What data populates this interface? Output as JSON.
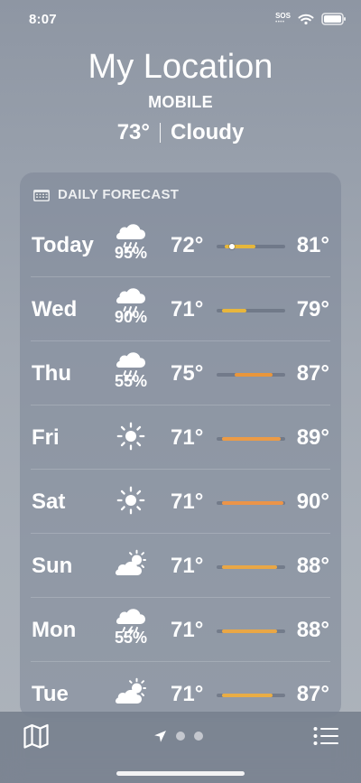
{
  "status_bar": {
    "time": "8:07",
    "sos": "SOS"
  },
  "header": {
    "location_name": "My Location",
    "subtitle": "MOBILE",
    "current_temperature": "73°",
    "current_condition": "Cloudy"
  },
  "forecast": {
    "title": "DAILY FORECAST",
    "days": [
      {
        "day": "Today",
        "icon": "cloud-rain-icon",
        "precip": "95%",
        "low": "72°",
        "high": "81°",
        "range_start": 0.12,
        "range_end": 0.57,
        "current_marker": 0.22,
        "range_color": "#e6b73b"
      },
      {
        "day": "Wed",
        "icon": "cloud-rain-icon",
        "precip": "90%",
        "low": "71°",
        "high": "79°",
        "range_start": 0.08,
        "range_end": 0.44,
        "range_color": "#e8b63c"
      },
      {
        "day": "Thu",
        "icon": "cloud-rain-icon",
        "precip": "55%",
        "low": "75°",
        "high": "87°",
        "range_start": 0.26,
        "range_end": 0.82,
        "range_color": "#e9963b"
      },
      {
        "day": "Fri",
        "icon": "sun-icon",
        "precip": "",
        "low": "71°",
        "high": "89°",
        "range_start": 0.08,
        "range_end": 0.93,
        "range_color": "#ec9b46"
      },
      {
        "day": "Sat",
        "icon": "sun-icon",
        "precip": "",
        "low": "71°",
        "high": "90°",
        "range_start": 0.08,
        "range_end": 0.98,
        "range_color": "#ec9448"
      },
      {
        "day": "Sun",
        "icon": "partly-sunny-icon",
        "precip": "",
        "low": "71°",
        "high": "88°",
        "range_start": 0.08,
        "range_end": 0.88,
        "range_color": "#e9a746"
      },
      {
        "day": "Mon",
        "icon": "cloud-thunderstorm-icon",
        "precip": "55%",
        "low": "71°",
        "high": "88°",
        "range_start": 0.08,
        "range_end": 0.88,
        "range_color": "#e9a746"
      },
      {
        "day": "Tue",
        "icon": "partly-sunny-icon",
        "precip": "",
        "low": "71°",
        "high": "87°",
        "range_start": 0.08,
        "range_end": 0.82,
        "range_color": "#e9ad45"
      }
    ]
  },
  "bottom_bar": {
    "map_icon": "map-icon",
    "location_icon": "location-arrow-icon",
    "list_icon": "list-icon",
    "page_count": 3,
    "current_page": 0
  },
  "colors": {
    "card_background": "#7a8595",
    "track": "#5b6474",
    "text": "#ffffff"
  }
}
